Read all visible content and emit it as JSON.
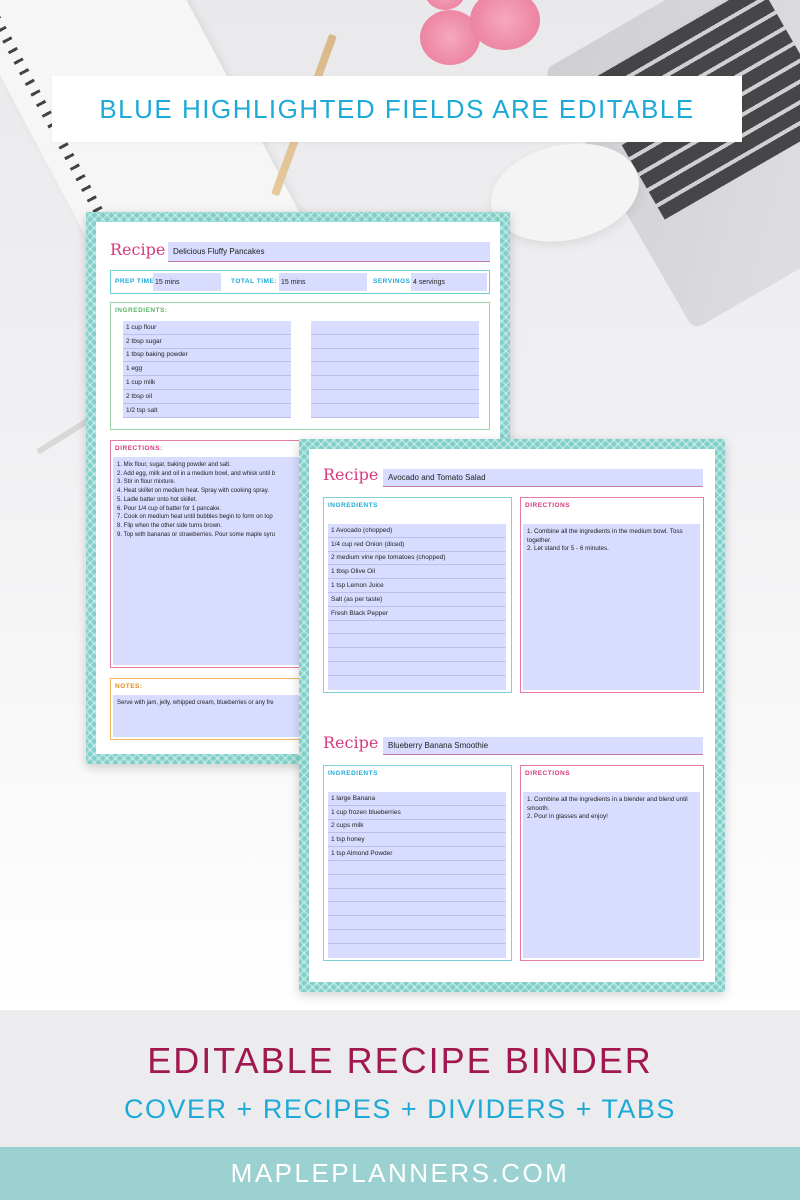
{
  "banner": {
    "text": "BLUE HIGHLIGHTED FIELDS ARE EDITABLE"
  },
  "colors": {
    "accent_blue": "#1eaad6",
    "accent_magenta": "#a0184f",
    "teal_frame": "#7fcfc8",
    "editable_field": "#d8dcff"
  },
  "sheet1": {
    "recipe_label": "Recipe",
    "recipe_name": "Delicious Fluffy Pancakes",
    "prep_label": "PREP TIME:",
    "prep_value": "15 mins",
    "total_label": "TOTAL TIME:",
    "total_value": "15 mins",
    "servings_label": "SERVINGS:",
    "servings_value": "4 servings",
    "ingredients_label": "INGREDIENTS:",
    "ingredients": [
      "1 cup flour",
      "2 tbsp sugar",
      "1 tbsp baking powder",
      "1 egg",
      "1 cup milk",
      "2 tbsp oil",
      "1/2 tsp salt"
    ],
    "directions_label": "DIRECTIONS:",
    "directions": "1. Mix flour, sugar, baking powder and salt.\n2. Add egg, milk and oil in a medium bowl, and whisk until b\n3. Stir in flour mixture.\n4. Heat skillet on medium heat. Spray with cooking spray.\n5. Ladle batter onto hot skillet.\n6. Pour 1/4 cup of batter for 1 pancake.\n7. Cook on medium heat until bubbles begin to form on top\n8. Flip when the other side turns brown.\n9. Top with bananas or strawberries. Pour some maple syru",
    "notes_label": "NOTES:",
    "notes": "Serve with jam, jelly, whipped cream, blueberries or any fre"
  },
  "sheet2": {
    "recipes": [
      {
        "recipe_label": "Recipe",
        "recipe_name": "Avocado and Tomato Salad",
        "ingredients_label": "INGREDIENTS",
        "ingredients": [
          "1 Avocado (chopped)",
          "1/4 cup red Onion (diced)",
          "2 medium vine ripe tomatoes (chopped)",
          "1 tbsp Olive Oil",
          "1 tsp Lemon Juice",
          "Salt (as per taste)",
          "Fresh Black Pepper",
          "",
          "",
          "",
          ""
        ],
        "directions_label": "DIRECTIONS",
        "directions": "1. Combine all the ingredients in the medium bowl. Toss together.\n2. Let stand for 5 - 6 minutes."
      },
      {
        "recipe_label": "Recipe",
        "recipe_name": "Blueberry Banana Smoothie",
        "ingredients_label": "INGREDIENTS",
        "ingredients": [
          "1 large Banana",
          "1 cup frozen blueberries",
          "2 cups milk",
          "1 tsp honey",
          "1 tsp Almond Powder",
          "",
          "",
          "",
          "",
          "",
          ""
        ],
        "directions_label": "DIRECTIONS",
        "directions": "1. Combine all the ingredients in a blender and blend until smooth.\n2. Pour in glasses and enjoy!"
      }
    ]
  },
  "bottom": {
    "title": "EDITABLE RECIPE BINDER",
    "subtitle": "COVER + RECIPES + DIVIDERS + TABS",
    "website": "MAPLEPLANNERS.COM"
  }
}
